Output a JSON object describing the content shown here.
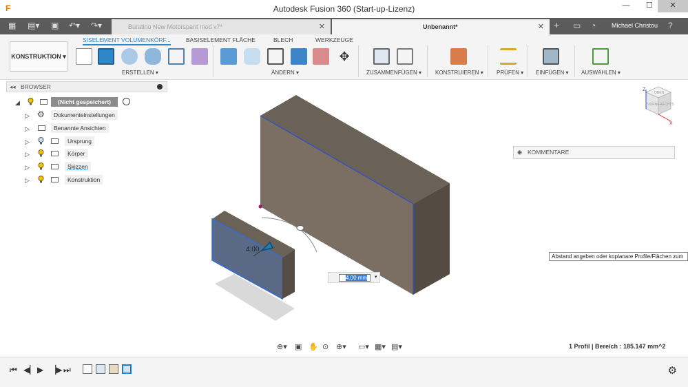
{
  "window": {
    "app_icon": "F",
    "title": "Autodesk Fusion 360 (Start-up-Lizenz)",
    "minimize": "—",
    "maximize": "☐",
    "close": "✕"
  },
  "tabs": [
    {
      "label": "Buratino New Motorspant mod v7*",
      "close": "✕",
      "active": false
    },
    {
      "label": "Unbenannt*",
      "close": "✕",
      "active": true
    }
  ],
  "user": {
    "name": "Michael Christou"
  },
  "ribbon": {
    "workspace": "KONSTRUKTION ▾",
    "tabs": [
      "SISELEMENT VOLUMENKÖRF...",
      "BASISELEMENT FLÄCHE",
      "BLECH",
      "WERKZEUGE"
    ],
    "groups": [
      "ERSTELLEN ▾",
      "ÄNDERN ▾",
      "ZUSAMMENFÜGEN ▾",
      "KONSTRUIEREN ▾",
      "PRÜFEN ▾",
      "EINFÜGEN ▾",
      "AUSWÄHLEN ▾"
    ]
  },
  "browser": {
    "title": "BROWSER",
    "root": "(Nicht gespeichert)",
    "items": [
      {
        "label": "Dokumenteinstellungen"
      },
      {
        "label": "Benannte Ansichten"
      },
      {
        "label": "Ursprung"
      },
      {
        "label": "Körper"
      },
      {
        "label": "Skizzen"
      },
      {
        "label": "Konstruktion"
      }
    ]
  },
  "viewcube": {
    "top": "OBEN",
    "front": "VORNE",
    "right": "RECHTS",
    "axis_z": "Z",
    "axis_x": "X"
  },
  "comments": {
    "label": "KOMMENTARE"
  },
  "tooltip": {
    "text": "Abstand angeben oder koplanare Profile/Flächen zum"
  },
  "dimension": {
    "value": "4.00 mm",
    "label_3d": "4.00"
  },
  "status": {
    "text": "1 Profil | Bereich : 185.147 mm^2"
  },
  "colors": {
    "accent": "#2d87c9",
    "selected": "#1e7dc9",
    "body_top": "#6a6157",
    "body_front": "#7a6f62"
  }
}
